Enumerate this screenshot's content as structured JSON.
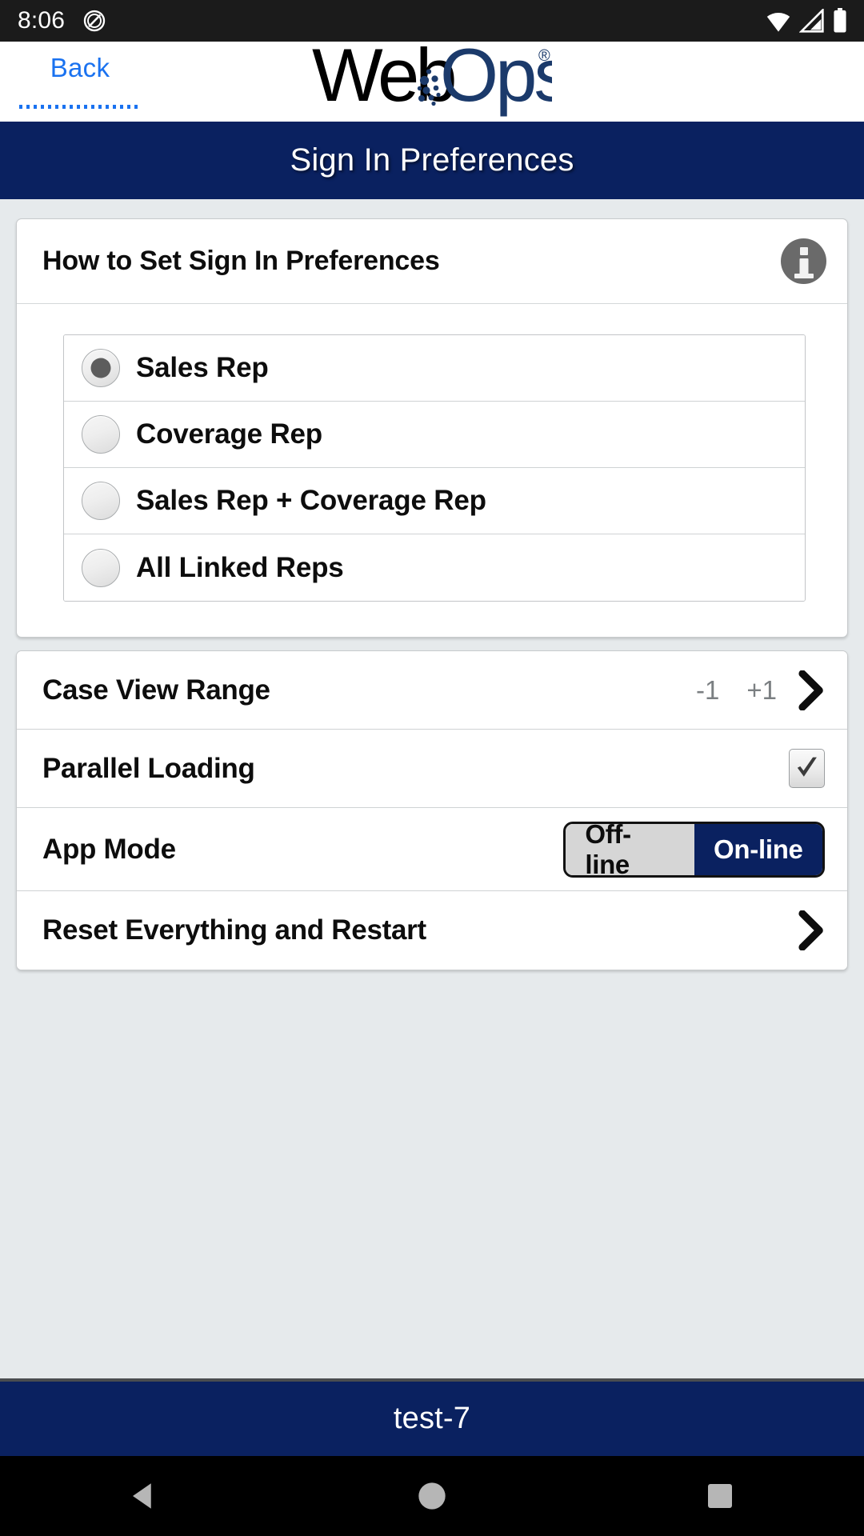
{
  "status_bar": {
    "time": "8:06",
    "dnd_icon": "do-not-disturb-icon",
    "wifi_icon": "wifi-icon",
    "signal_icon": "cellular-signal-icon",
    "battery_icon": "battery-full-icon"
  },
  "header": {
    "back_label": "Back",
    "logo_part1": "Web",
    "logo_part2": "Ops",
    "logo_registered": "®",
    "logo_color_dark": "#13274f",
    "logo_color_black": "#000000"
  },
  "title_bar": {
    "title": "Sign In Preferences",
    "bg_color": "#0a2160"
  },
  "info_card": {
    "heading": "How to Set Sign In Preferences",
    "info_icon": "info-icon",
    "radio_options": [
      {
        "label": "Sales Rep",
        "selected": true
      },
      {
        "label": "Coverage Rep",
        "selected": false
      },
      {
        "label": "Sales Rep + Coverage Rep",
        "selected": false
      },
      {
        "label": "All Linked Reps",
        "selected": false
      }
    ]
  },
  "settings_card": {
    "rows": [
      {
        "label": "Case View Range",
        "type": "range",
        "value_min": "-1",
        "value_max": "+1",
        "chevron": "chevron-right-icon"
      },
      {
        "label": "Parallel Loading",
        "type": "checkbox",
        "checked": true
      },
      {
        "label": "App Mode",
        "type": "segmented",
        "option_left": "Off-line",
        "option_right": "On-line",
        "selected": "On-line",
        "selected_color": "#0a2160"
      },
      {
        "label": "Reset Everything and Restart",
        "type": "link",
        "chevron": "chevron-right-icon"
      }
    ]
  },
  "footer": {
    "label": "test-7",
    "bg_color": "#0a2160"
  },
  "nav_bar": {
    "back_icon": "nav-back-triangle-icon",
    "home_icon": "nav-home-circle-icon",
    "recents_icon": "nav-recents-square-icon"
  }
}
